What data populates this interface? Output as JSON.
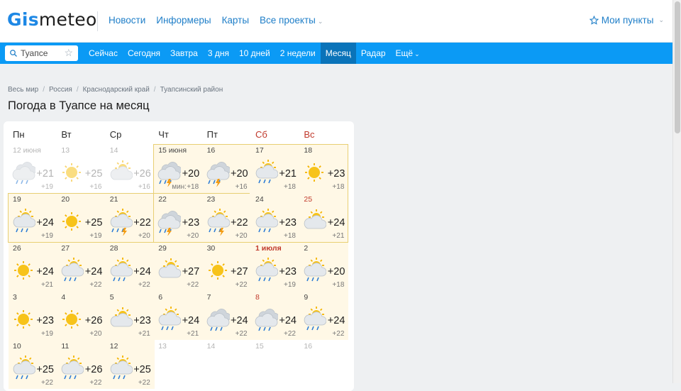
{
  "header": {
    "logo_part1": "Gis",
    "logo_part2": "meteo",
    "nav": [
      "Новости",
      "Информеры",
      "Карты",
      "Все проекты"
    ],
    "my_points": "Мои пункты"
  },
  "navbar": {
    "search_value": "Туапсе",
    "tabs": [
      "Сейчас",
      "Сегодня",
      "Завтра",
      "3 дня",
      "10 дней",
      "2 недели",
      "Месяц",
      "Радар",
      "Ещё"
    ],
    "active_tab": "Месяц"
  },
  "breadcrumbs": [
    "Весь мир",
    "Россия",
    "Краснодарский край",
    "Туапсинский район"
  ],
  "page_title": "Погода в Туапсе на месяц",
  "weekdays": [
    "Пн",
    "Вт",
    "Ср",
    "Чт",
    "Пт",
    "Сб",
    "Вс"
  ],
  "min_label": "мин:",
  "calendar": [
    [
      {
        "day": "12 июня",
        "max": "+21",
        "min": "+19",
        "icon": "cloud-rain-icon",
        "past": true
      },
      {
        "day": "13",
        "max": "+25",
        "min": "+16",
        "icon": "sun-icon",
        "past": true
      },
      {
        "day": "14",
        "max": "+26",
        "min": "+16",
        "icon": "sun-cloud-icon",
        "past": true
      },
      {
        "day": "15 июня",
        "max": "+20",
        "min": "+18",
        "icon": "cloud-storm-icon",
        "today": true
      },
      {
        "day": "16",
        "max": "+20",
        "min": "+16",
        "icon": "cloud-storm-icon"
      },
      {
        "day": "17",
        "max": "+21",
        "min": "+18",
        "icon": "sun-cloud-rain-icon"
      },
      {
        "day": "18",
        "max": "+23",
        "min": "+18",
        "icon": "sun-icon"
      }
    ],
    [
      {
        "day": "19",
        "max": "+24",
        "min": "+19",
        "icon": "sun-cloud-rain-icon"
      },
      {
        "day": "20",
        "max": "+25",
        "min": "+19",
        "icon": "sun-icon"
      },
      {
        "day": "21",
        "max": "+22",
        "min": "+20",
        "icon": "sun-cloud-storm-icon"
      },
      {
        "day": "22",
        "max": "+23",
        "min": "+20",
        "icon": "cloud-storm-icon"
      },
      {
        "day": "23",
        "max": "+22",
        "min": "+20",
        "icon": "sun-cloud-storm-icon"
      },
      {
        "day": "24",
        "max": "+23",
        "min": "+18",
        "icon": "sun-cloud-rain-icon"
      },
      {
        "day": "25",
        "max": "+24",
        "min": "+21",
        "icon": "sun-cloud-icon",
        "weekend": true
      }
    ],
    [
      {
        "day": "26",
        "max": "+24",
        "min": "+21",
        "icon": "sun-icon"
      },
      {
        "day": "27",
        "max": "+24",
        "min": "+22",
        "icon": "sun-cloud-rain-icon"
      },
      {
        "day": "28",
        "max": "+24",
        "min": "+22",
        "icon": "sun-cloud-rain-icon"
      },
      {
        "day": "29",
        "max": "+27",
        "min": "+22",
        "icon": "sun-cloud-icon"
      },
      {
        "day": "30",
        "max": "+27",
        "min": "+22",
        "icon": "sun-icon"
      },
      {
        "day": "1 июля",
        "max": "+23",
        "min": "+19",
        "icon": "sun-cloud-rain-icon",
        "weekend": true,
        "bold": true
      },
      {
        "day": "2",
        "max": "+20",
        "min": "+18",
        "icon": "sun-cloud-rain-icon"
      }
    ],
    [
      {
        "day": "3",
        "max": "+23",
        "min": "+19",
        "icon": "sun-icon"
      },
      {
        "day": "4",
        "max": "+26",
        "min": "+20",
        "icon": "sun-icon"
      },
      {
        "day": "5",
        "max": "+23",
        "min": "+21",
        "icon": "sun-cloud-icon"
      },
      {
        "day": "6",
        "max": "+24",
        "min": "+21",
        "icon": "sun-cloud-rain-icon"
      },
      {
        "day": "7",
        "max": "+24",
        "min": "+22",
        "icon": "cloud-rain-icon"
      },
      {
        "day": "8",
        "max": "+24",
        "min": "+22",
        "icon": "cloud-rain-icon",
        "weekend": true
      },
      {
        "day": "9",
        "max": "+24",
        "min": "+22",
        "icon": "sun-cloud-rain-icon"
      }
    ],
    [
      {
        "day": "10",
        "max": "+25",
        "min": "+22",
        "icon": "sun-cloud-rain-icon"
      },
      {
        "day": "11",
        "max": "+26",
        "min": "+22",
        "icon": "sun-cloud-rain-icon"
      },
      {
        "day": "12",
        "max": "+25",
        "min": "+22",
        "icon": "sun-cloud-rain-icon"
      },
      {
        "day": "13",
        "past": true,
        "empty": true
      },
      {
        "day": "14",
        "past": true,
        "empty": true
      },
      {
        "day": "15",
        "past": true,
        "empty": true
      },
      {
        "day": "16",
        "past": true,
        "empty": true
      }
    ]
  ],
  "colors": {
    "accent": "#0b9af5",
    "active_tab": "#0a73b9",
    "weekend": "#c0392b",
    "highlight": "#fff8e6",
    "highlight_border": "#e8cf73"
  }
}
